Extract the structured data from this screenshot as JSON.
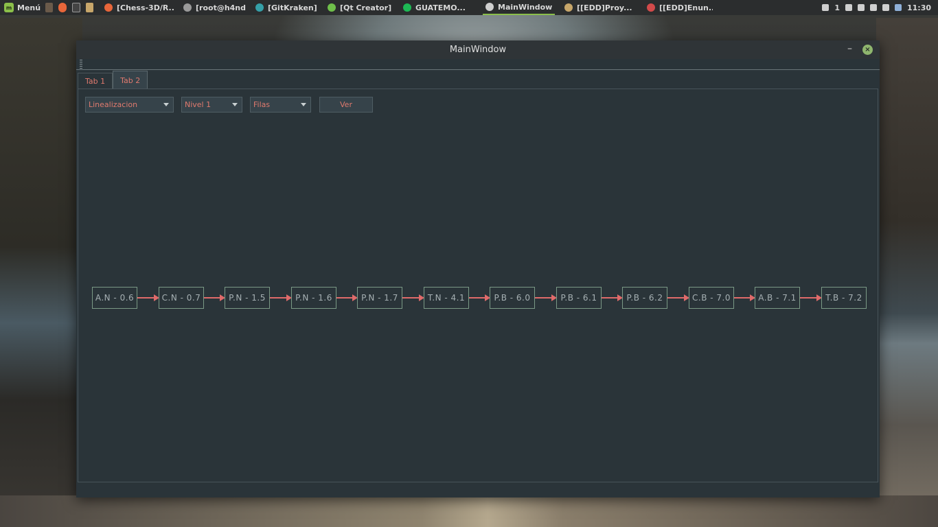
{
  "panel": {
    "menu_label": "Menú",
    "tasks": [
      {
        "label": "[Chess-3D/R...",
        "icon": "firefox-icon",
        "color": "#e8663a"
      },
      {
        "label": "[root@h4nd...",
        "icon": "terminal-icon",
        "color": "#9a9a9a"
      },
      {
        "label": "[GitKraken]",
        "icon": "gitkraken-icon",
        "color": "#35a0a8"
      },
      {
        "label": "[Qt Creator]",
        "icon": "qt-creator-icon",
        "color": "#6fbf4a"
      },
      {
        "label": "GUATEMO...",
        "icon": "spotify-icon",
        "color": "#1db954"
      },
      {
        "label": "MainWindow",
        "icon": "window-icon",
        "color": "#cfcfcf"
      },
      {
        "label": "[[EDD]Proy...",
        "icon": "folder-icon",
        "color": "#c7a66a"
      },
      {
        "label": "[[EDD]Enun...",
        "icon": "document-icon",
        "color": "#d24a4a"
      }
    ],
    "active_task": "MainWindow",
    "notification_count": "1",
    "clock": "11:30"
  },
  "window": {
    "title": "MainWindow",
    "tabs": [
      {
        "label": "Tab 1"
      },
      {
        "label": "Tab 2"
      }
    ],
    "active_tab": "Tab 2",
    "combos": {
      "mode": "Linealizacion",
      "level": "Nivel 1",
      "order": "Filas"
    },
    "view_button": "Ver"
  },
  "chain_nodes": [
    "A.N - 0.6",
    "C.N - 0.7",
    "P.N - 1.5",
    "P.N - 1.6",
    "P.N - 1.7",
    "T.N - 4.1",
    "P.B - 6.0",
    "P.B - 6.1",
    "P.B - 6.2",
    "C.B - 7.0",
    "A.B - 7.1",
    "T.B - 7.2"
  ],
  "colors": {
    "window_bg": "#2a3439",
    "accent_text": "#e07a6e",
    "node_border": "#7b9a86",
    "edge": "#e06a6a"
  }
}
